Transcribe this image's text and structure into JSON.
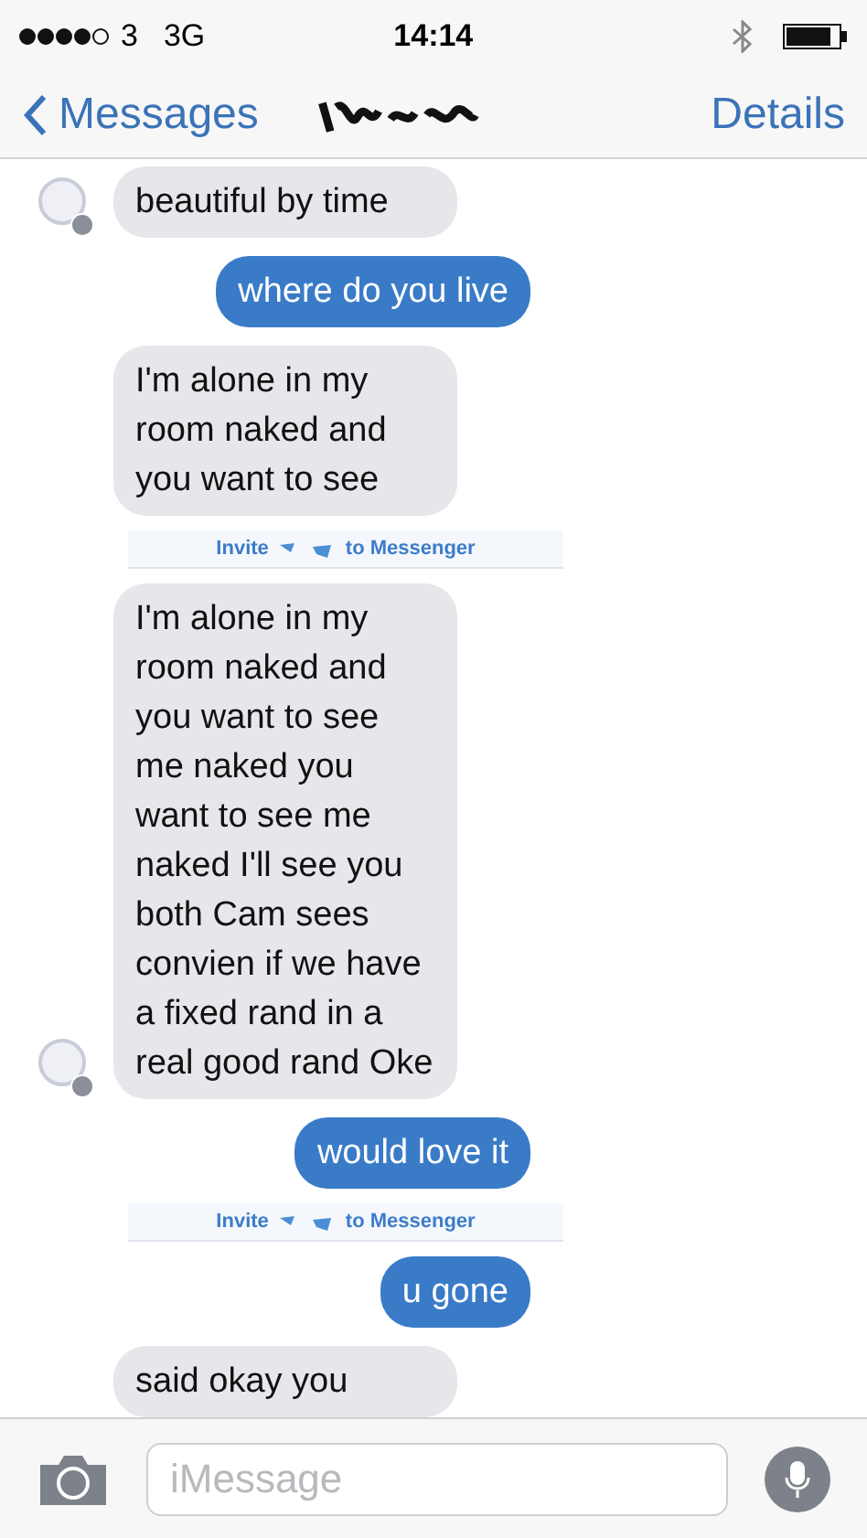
{
  "status_bar": {
    "carrier": "3",
    "network": "3G",
    "time": "14:14"
  },
  "nav": {
    "back": "Messages",
    "details": "Details"
  },
  "messages": [
    {
      "kind": "incoming",
      "text": "beautiful by time",
      "avatar": true
    },
    {
      "kind": "outgoing",
      "text": "where do you live"
    },
    {
      "kind": "incoming",
      "text": "I'm alone in my room naked and you want to see",
      "avatar": false
    },
    {
      "kind": "banner",
      "before": "Invite",
      "after": "to Messenger"
    },
    {
      "kind": "incoming",
      "text": "I'm alone in my room naked and you want to see me naked you want to see me naked I'll see you both Cam sees convien if we have a fixed rand in a real good rand Oke",
      "avatar": true
    },
    {
      "kind": "outgoing",
      "text": "would love it"
    },
    {
      "kind": "banner",
      "before": "Invite",
      "after": "to Messenger"
    },
    {
      "kind": "outgoing",
      "text": "u gone"
    },
    {
      "kind": "incoming",
      "text": "said okay you",
      "avatar": false
    }
  ],
  "composer": {
    "placeholder": "iMessage"
  }
}
